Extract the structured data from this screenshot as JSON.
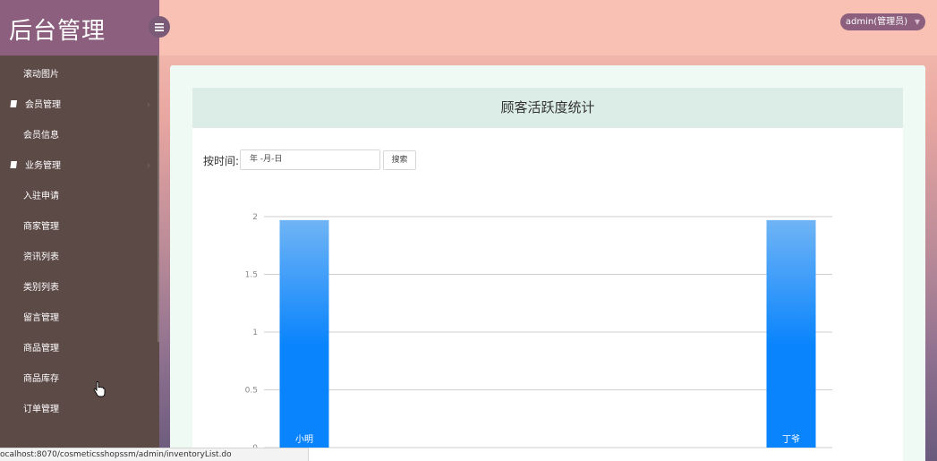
{
  "app": {
    "brand_title": "后台管理"
  },
  "header": {
    "user_label": "admin(管理员)"
  },
  "sidebar": {
    "items": [
      {
        "label": "滚动图片",
        "group": false
      },
      {
        "label": "会员管理",
        "group": true
      },
      {
        "label": "会员信息",
        "group": false
      },
      {
        "label": "业务管理",
        "group": true
      },
      {
        "label": "入驻申请",
        "group": false
      },
      {
        "label": "商家管理",
        "group": false
      },
      {
        "label": "资讯列表",
        "group": false
      },
      {
        "label": "类别列表",
        "group": false
      },
      {
        "label": "留言管理",
        "group": false
      },
      {
        "label": "商品管理",
        "group": false
      },
      {
        "label": "商品库存",
        "group": false
      },
      {
        "label": "订单管理",
        "group": false
      }
    ]
  },
  "panel": {
    "title": "顾客活跃度统计",
    "filter_label": "按时间:",
    "date_placeholder": "年 -月-日",
    "search_button": "搜索"
  },
  "chart_data": {
    "type": "bar",
    "categories": [
      "小明",
      "丁爷"
    ],
    "values": [
      1.97,
      1.97
    ],
    "ylim": [
      0,
      2
    ],
    "yticks": [
      "0",
      "0.5",
      "1",
      "1.5",
      "2"
    ],
    "grid": true,
    "colors": {
      "bar_top": "#6fb4f5",
      "bar_bottom": "#0a84fd"
    }
  },
  "status_bar": {
    "url": "ocalhost:8070/cosmeticsshopssm/admin/inventoryList.do"
  }
}
